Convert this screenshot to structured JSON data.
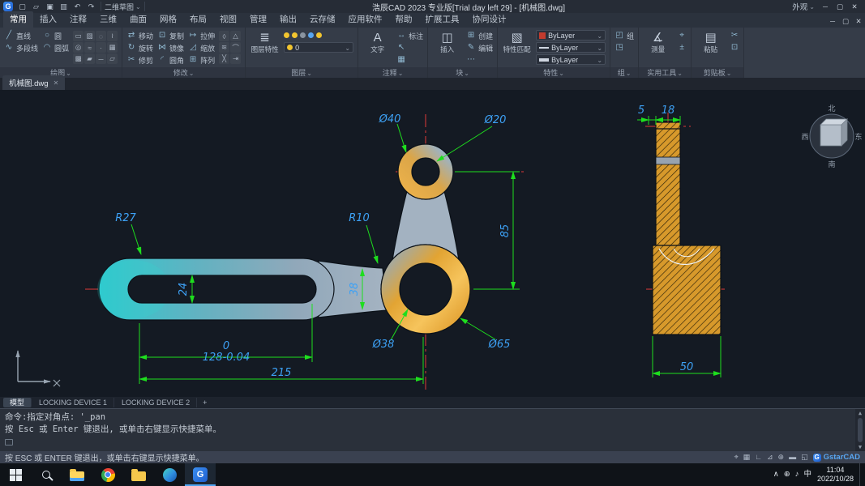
{
  "titlebar": {
    "logo_text": "G",
    "qat": [
      {
        "name": "new-file-icon",
        "icon": "new"
      },
      {
        "name": "open-file-icon",
        "icon": "open"
      },
      {
        "name": "save-icon",
        "icon": "save"
      },
      {
        "name": "print-icon",
        "icon": "print"
      },
      {
        "name": "undo-icon",
        "icon": "undo"
      },
      {
        "name": "redo-icon",
        "icon": "redo"
      }
    ],
    "workspace": "二维草图",
    "title": "浩辰CAD 2023 专业版[Trial day left 29] - [机械图.dwg]",
    "appearance": "外观",
    "window_buttons": [
      {
        "name": "minimize-button",
        "glyph": "─"
      },
      {
        "name": "restore-button",
        "glyph": "▢"
      },
      {
        "name": "close-button",
        "glyph": "✕"
      }
    ]
  },
  "menubar": {
    "tabs": [
      {
        "label": "常用",
        "active": true
      },
      {
        "label": "插入"
      },
      {
        "label": "注释"
      },
      {
        "label": "三维"
      },
      {
        "label": "曲面"
      },
      {
        "label": "网格"
      },
      {
        "label": "布局"
      },
      {
        "label": "视图"
      },
      {
        "label": "管理"
      },
      {
        "label": "输出"
      },
      {
        "label": "云存储"
      },
      {
        "label": "应用软件"
      },
      {
        "label": "帮助"
      },
      {
        "label": "扩展工具"
      },
      {
        "label": "协同设计"
      }
    ],
    "window_buttons": [
      {
        "name": "doc-minimize-button",
        "glyph": "─"
      },
      {
        "name": "doc-restore-button",
        "glyph": "▢"
      },
      {
        "name": "doc-close-button",
        "glyph": "✕"
      }
    ]
  },
  "ribbon": {
    "panels": [
      {
        "caption": "绘图",
        "rows": 2,
        "small": [
          {
            "icon": "line",
            "label": "直线"
          },
          {
            "icon": "polyline",
            "label": "多段线"
          },
          {
            "icon": "circle",
            "label": "圆"
          },
          {
            "icon": "arc",
            "label": "圆弧"
          }
        ],
        "tiny": [
          "rect",
          "hatch",
          "ellipse",
          "spline",
          "donut",
          "revcloud",
          "point",
          "table",
          "gradient",
          "region",
          "xline",
          "boundary"
        ]
      },
      {
        "caption": "修改",
        "rows": 3,
        "small": [
          {
            "icon": "move",
            "label": "移动"
          },
          {
            "icon": "rotate",
            "label": "旋转"
          },
          {
            "icon": "trim",
            "label": "修剪"
          },
          {
            "icon": "copy",
            "label": "复制"
          },
          {
            "icon": "mirror",
            "label": "镜像"
          },
          {
            "icon": "fillet",
            "label": "圆角"
          },
          {
            "icon": "stretch",
            "label": "拉伸"
          },
          {
            "icon": "scale",
            "label": "缩放"
          },
          {
            "icon": "array",
            "label": "阵列"
          }
        ],
        "tiny": [
          "erase",
          "explode",
          "offset",
          "join",
          "break",
          "lengthen"
        ]
      },
      {
        "caption": "图层",
        "big": [
          {
            "icon": "layers",
            "label": "图层特性"
          }
        ],
        "layer_tiny": [
          "dot-yellow",
          "dot-yellow",
          "dot-gray",
          "dot-blue",
          "dot-yellow"
        ],
        "layer_dropdown": {
          "value": "0"
        }
      },
      {
        "caption": "注释",
        "rows": 3,
        "big": [
          {
            "icon": "text",
            "label": "文字"
          }
        ],
        "small": [
          {
            "icon": "dim",
            "label": "标注"
          },
          {
            "icon": "leader",
            "label": ""
          },
          {
            "icon": "table",
            "label": ""
          }
        ]
      },
      {
        "caption": "块",
        "rows": 3,
        "big": [
          {
            "icon": "insert",
            "label": "插入"
          }
        ],
        "small": [
          {
            "icon": "create",
            "label": "创建"
          },
          {
            "icon": "edit",
            "label": "编辑"
          },
          {
            "icon": "attrib",
            "label": ""
          }
        ]
      },
      {
        "caption": "特性",
        "big": [
          {
            "icon": "matchprops",
            "label": "特性匹配"
          }
        ],
        "prop_dropdowns": [
          {
            "name": "color-dropdown",
            "swatch": "color",
            "value": "ByLayer"
          },
          {
            "name": "linetype-dropdown",
            "swatch": "linetype",
            "value": "ByLayer"
          },
          {
            "name": "lineweight-dropdown",
            "swatch": "lineweight",
            "value": "ByLayer"
          }
        ]
      },
      {
        "caption": "组",
        "rows": 2,
        "small": [
          {
            "icon": "group",
            "label": "组"
          },
          {
            "icon": "ungroup",
            "label": ""
          }
        ]
      },
      {
        "caption": "实用工具",
        "rows": 2,
        "big": [
          {
            "icon": "measure",
            "label": "测量"
          }
        ],
        "small": [
          {
            "icon": "select",
            "label": ""
          },
          {
            "icon": "calc",
            "label": ""
          }
        ]
      },
      {
        "caption": "剪贴板",
        "rows": 2,
        "big": [
          {
            "icon": "paste",
            "label": "粘贴"
          }
        ],
        "small": [
          {
            "icon": "cut",
            "label": ""
          },
          {
            "icon": "copyclip",
            "label": ""
          }
        ]
      }
    ]
  },
  "docbar": {
    "tabs": [
      {
        "label": "机械图.dwg",
        "active": true
      }
    ],
    "close_glyph": "✕"
  },
  "canvas": {
    "dims": {
      "dia40": "Ø40",
      "dia20": "Ø20",
      "r27": "R27",
      "r10": "R10",
      "v85": "85",
      "v24": "24",
      "v38": "38",
      "tol_upper": "0",
      "v128": "128-0.04",
      "v215": "215",
      "dia38": "Ø38",
      "dia65": "Ø65",
      "v5": "5",
      "v18": "18",
      "v50": "50"
    },
    "viewcube": {
      "north": "北",
      "south": "南",
      "west": "西",
      "east": "东"
    },
    "colors": {
      "dimension_text": "#3da1f5",
      "dimension_line": "#1ede1e",
      "centerline": "#e03a3a",
      "part_teal": "#2ec5cb",
      "part_steel": "#9fb0bf",
      "part_orange": "#eab04a",
      "background": "#141a23"
    }
  },
  "layoutbar": {
    "tabs": [
      {
        "label": "模型",
        "active": true
      },
      {
        "label": "LOCKING DEVICE 1"
      },
      {
        "label": "LOCKING DEVICE 2"
      }
    ],
    "add_label": "+"
  },
  "command": {
    "line1": "命令:指定对角点: '_pan",
    "line2": "按 Esc 或 Enter 键退出, 或单击右键显示快捷菜单。"
  },
  "statusbar": {
    "message": "按 ESC 或 ENTER 键退出，或单击右键显示快捷菜单。",
    "icons": [
      {
        "name": "snap-icon",
        "glyph": "⌖"
      },
      {
        "name": "grid-icon",
        "glyph": "▦"
      },
      {
        "name": "ortho-icon",
        "glyph": "∟"
      },
      {
        "name": "polar-icon",
        "glyph": "⊿"
      },
      {
        "name": "osnap-icon",
        "glyph": "⊕"
      },
      {
        "name": "lineweight-icon",
        "glyph": "▬"
      },
      {
        "name": "fullscreen-icon",
        "glyph": "◱"
      }
    ],
    "brand": "GstarCAD"
  },
  "taskbar": {
    "items": [
      {
        "name": "start",
        "kind": "start"
      },
      {
        "name": "search",
        "kind": "search"
      },
      {
        "name": "file-explorer",
        "kind": "explorer"
      },
      {
        "name": "chrome",
        "kind": "chrome"
      },
      {
        "name": "folder",
        "kind": "folder"
      },
      {
        "name": "edge",
        "kind": "edge"
      },
      {
        "name": "gstarcad",
        "kind": "g",
        "glyph": "G",
        "active": true
      }
    ],
    "tray": [
      {
        "name": "hidden-icons-chevron",
        "glyph": "∧"
      },
      {
        "name": "network-icon",
        "glyph": "⊕"
      },
      {
        "name": "volume-icon",
        "glyph": "♪"
      },
      {
        "name": "language-indicator",
        "glyph": "中"
      }
    ],
    "clock": {
      "time": "11:04",
      "date": "2022/10/28"
    }
  }
}
